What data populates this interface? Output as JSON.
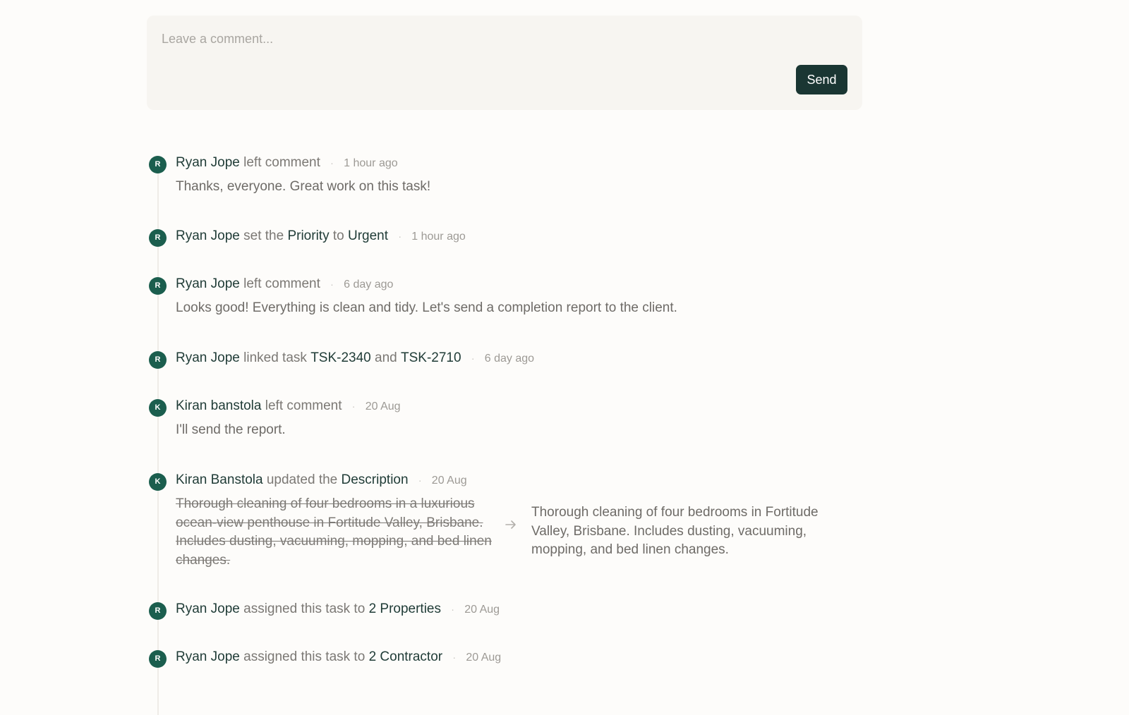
{
  "composer": {
    "placeholder": "Leave a comment...",
    "send_label": "Send"
  },
  "colors": {
    "accent": "#1a3633",
    "avatar": "#1b5e4e",
    "composer_bg": "#f7f5f1"
  },
  "events": [
    {
      "initial": "R",
      "actor": "Ryan Jope",
      "action": "left comment",
      "time": "1 hour ago",
      "comment": "Thanks, everyone. Great work on this task!"
    },
    {
      "initial": "R",
      "actor": "Ryan Jope",
      "action_pre": "set the",
      "field": "Priority",
      "action_mid": "to",
      "value": "Urgent",
      "time": "1 hour ago"
    },
    {
      "initial": "R",
      "actor": "Ryan Jope",
      "action": "left comment",
      "time": "6 day ago",
      "comment": "Looks good! Everything is clean and tidy. Let's send a completion report to the client."
    },
    {
      "initial": "R",
      "actor": "Ryan Jope",
      "action_pre": "linked task",
      "task_a": "TSK-2340",
      "action_mid": "and",
      "task_b": "TSK-2710",
      "time": "6 day ago"
    },
    {
      "initial": "K",
      "actor": "Kiran banstola",
      "action": "left comment",
      "time": "20 Aug",
      "comment": "I'll send the report."
    },
    {
      "initial": "K",
      "actor": "Kiran Banstola",
      "action_pre": "updated the",
      "field": "Description",
      "time": "20 Aug",
      "old_value": "Thorough cleaning of four bedrooms in a luxurious ocean-view penthouse in Fortitude Valley, Brisbane. Includes dusting, vacuuming, mopping, and bed linen changes.",
      "new_value": "Thorough cleaning of four bedrooms in Fortitude Valley, Brisbane. Includes dusting, vacuuming, mopping, and bed linen changes."
    },
    {
      "initial": "R",
      "actor": "Ryan Jope",
      "action_pre": "assigned this task to",
      "target": "2 Properties",
      "time": "20 Aug"
    },
    {
      "initial": "R",
      "actor": "Ryan Jope",
      "action_pre": "assigned this task to",
      "target": "2 Contractor",
      "time": "20 Aug"
    }
  ],
  "icons": {
    "arrow": "arrow-right-icon",
    "separator": "·"
  }
}
